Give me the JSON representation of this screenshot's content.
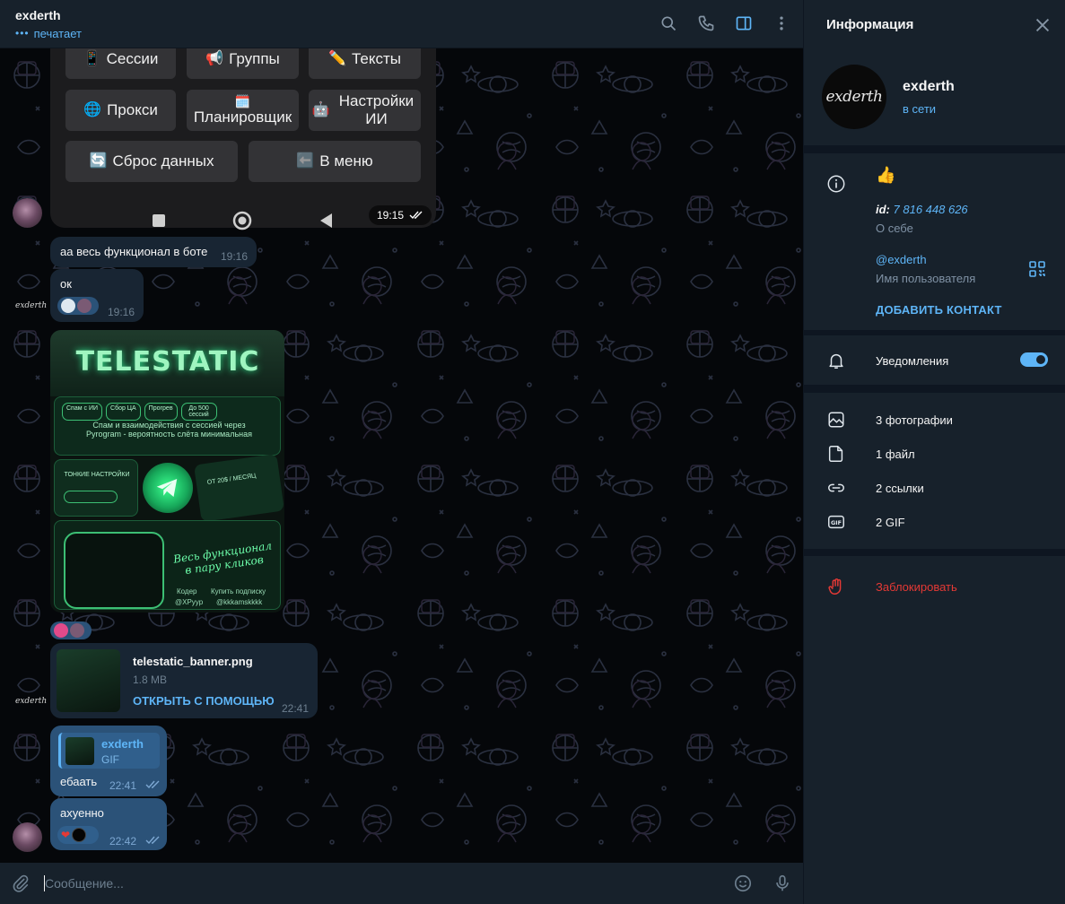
{
  "header": {
    "name": "exderth",
    "status": "печатает",
    "icons": [
      "search-icon",
      "phone-icon",
      "sidebar-toggle-icon",
      "more-vertical-icon"
    ]
  },
  "keyboard": {
    "buttons": [
      {
        "emoji": "📱",
        "label": "Сессии"
      },
      {
        "emoji": "📢",
        "label": "Группы"
      },
      {
        "emoji": "✏️",
        "label": "Тексты"
      },
      {
        "emoji": "🌐",
        "label": "Прокси"
      },
      {
        "emoji": "🗓️",
        "label": "Планировщик"
      },
      {
        "emoji": "🤖",
        "label": "Настройки ИИ"
      },
      {
        "emoji": "🔄",
        "label": "Сброс данных"
      },
      {
        "emoji": "⬅️",
        "label": "В меню"
      }
    ],
    "time": "19:15"
  },
  "messages": [
    {
      "text": "аа весь функционал в боте",
      "time": "19:16"
    },
    {
      "text": "ок",
      "time": "19:16"
    },
    {
      "file_name": "telestatic_banner.png",
      "file_size": "1.8 MB",
      "open_with": "ОТКРЫТЬ С ПОМОЩЬЮ",
      "time": "22:41"
    },
    {
      "reply_name": "exderth",
      "reply_type": "GIF",
      "text": "ебаать",
      "time": "22:41"
    },
    {
      "text": "ахуенно",
      "time": "22:42"
    }
  ],
  "banner_text": {
    "logo": "TELESTATIC",
    "tags": [
      "Спам с ИИ",
      "Сбор ЦА",
      "Прогрев",
      "До 500 сессий"
    ],
    "desc": "Спам и взаимодействия с сессией через Pyrogram - вероятность слёта минимальная",
    "fine": "ТОНКИЕ НАСТРОЙКИ",
    "price": "ОТ 20$ / МЕСЯЦ",
    "script": "Весь функционал в пару кликов",
    "coder_label": "Кодер",
    "coder": "@XPyyp",
    "buy_label": "Купить подписку",
    "buy": "@kkkamskkkk"
  },
  "composer": {
    "placeholder": "Сообщение..."
  },
  "info": {
    "title": "Информация",
    "name": "exderth",
    "avatar_text": "exderth",
    "status": "в сети",
    "bio": "👍",
    "id_label": "id:",
    "id_value": "7 816 448 626",
    "about_label": "О себе",
    "username": "@exderth",
    "username_label": "Имя пользователя",
    "add_contact": "ДОБАВИТЬ КОНТАКТ",
    "notifications": "Уведомления",
    "notifications_on": true,
    "media": [
      {
        "icon": "photo-icon",
        "label": "3 фотографии"
      },
      {
        "icon": "file-icon",
        "label": "1 файл"
      },
      {
        "icon": "link-icon",
        "label": "2 ссылки"
      },
      {
        "icon": "gif-icon",
        "label": "2 GIF"
      }
    ],
    "block": "Заблокировать"
  },
  "colors": {
    "accent": "#5eb5f7",
    "panel": "#17212b",
    "incoming": "#182533",
    "outgoing": "#2b5278",
    "danger": "#e53935"
  }
}
